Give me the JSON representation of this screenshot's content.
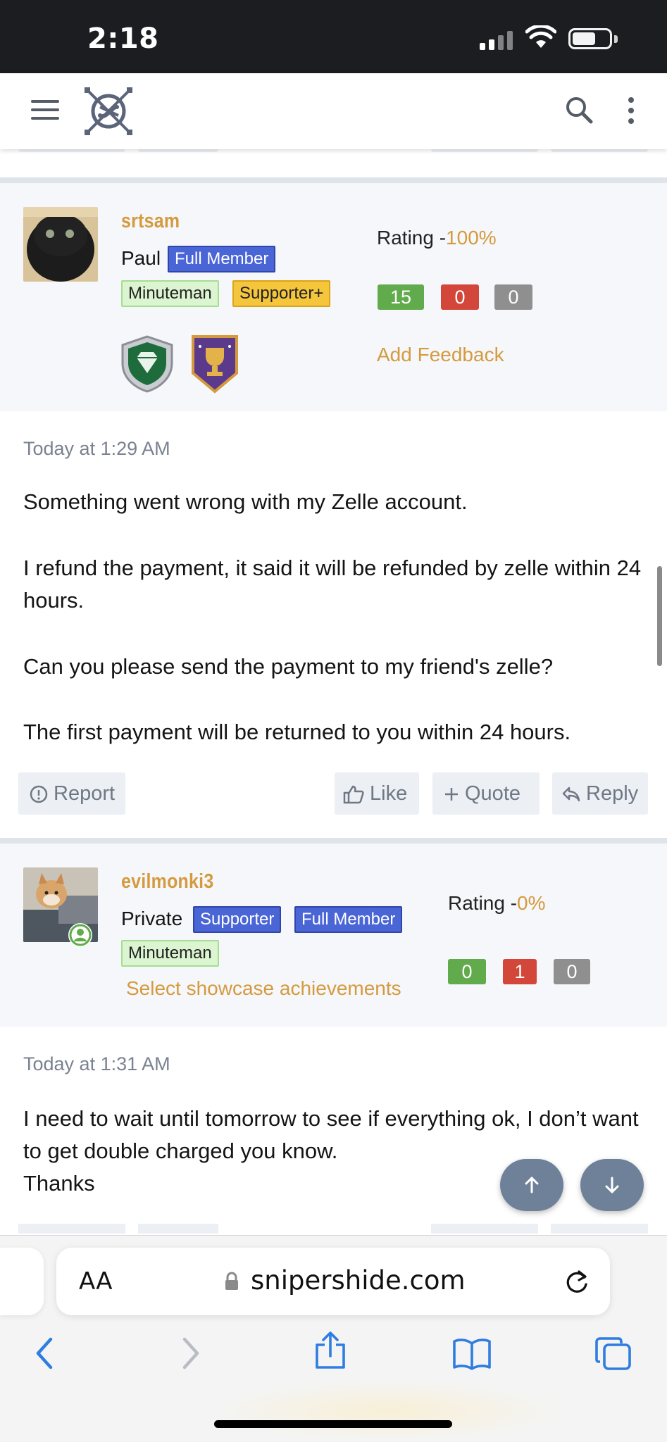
{
  "status_bar": {
    "time": "2:18"
  },
  "header": {
    "menu_icon": "hamburger-icon",
    "logo": "snipershide-logo",
    "search_icon": "search-icon",
    "more_icon": "kebab-icon"
  },
  "posts": [
    {
      "username": "srtsam",
      "user_title": "Paul",
      "badges": [
        "Full Member",
        "Minuteman",
        "Supporter+"
      ],
      "rating_label": "Rating -",
      "rating_pct": "100%",
      "feedback": {
        "positive": "15",
        "negative": "0",
        "neutral": "0"
      },
      "add_feedback": "Add Feedback",
      "trophies": [
        "diamond-shield-icon",
        "trophy-shield-icon"
      ],
      "date": "Today at 1:29 AM",
      "paragraphs": [
        "Something went wrong with my Zelle account.",
        "I refund the payment, it said it will be refunded by zelle within 24 hours.",
        "Can you please send the payment to my friend's zelle?",
        "The first payment will be returned to you within 24 hours."
      ],
      "actions": {
        "report": "Report",
        "like": "Like",
        "quote": "Quote",
        "reply": "Reply"
      }
    },
    {
      "username": "evilmonki3",
      "user_title": "Private",
      "badges": [
        "Supporter",
        "Full Member",
        "Minuteman"
      ],
      "rating_label": "Rating -",
      "rating_pct": "0%",
      "feedback": {
        "positive": "0",
        "negative": "1",
        "neutral": "0"
      },
      "showcase": "Select showcase achievements",
      "date": "Today at 1:31 AM",
      "paragraphs": [
        "I need to wait until tomorrow to see if everything ok, I don’t want to get double charged you know.",
        "Thanks"
      ]
    }
  ],
  "fabs": {
    "up": "arrow-up-icon",
    "down": "arrow-down-icon"
  },
  "browser": {
    "text_size": "AA",
    "url": "snipershide.com",
    "toolbar": [
      "back-icon",
      "forward-icon",
      "share-icon",
      "bookmarks-icon",
      "tabs-icon"
    ]
  },
  "colors": {
    "accent_gold": "#d59a3e",
    "badge_blue": "#4a65d6",
    "feedback_green": "#62ab4c",
    "feedback_red": "#d2473a",
    "feedback_grey": "#8f8f8f"
  }
}
